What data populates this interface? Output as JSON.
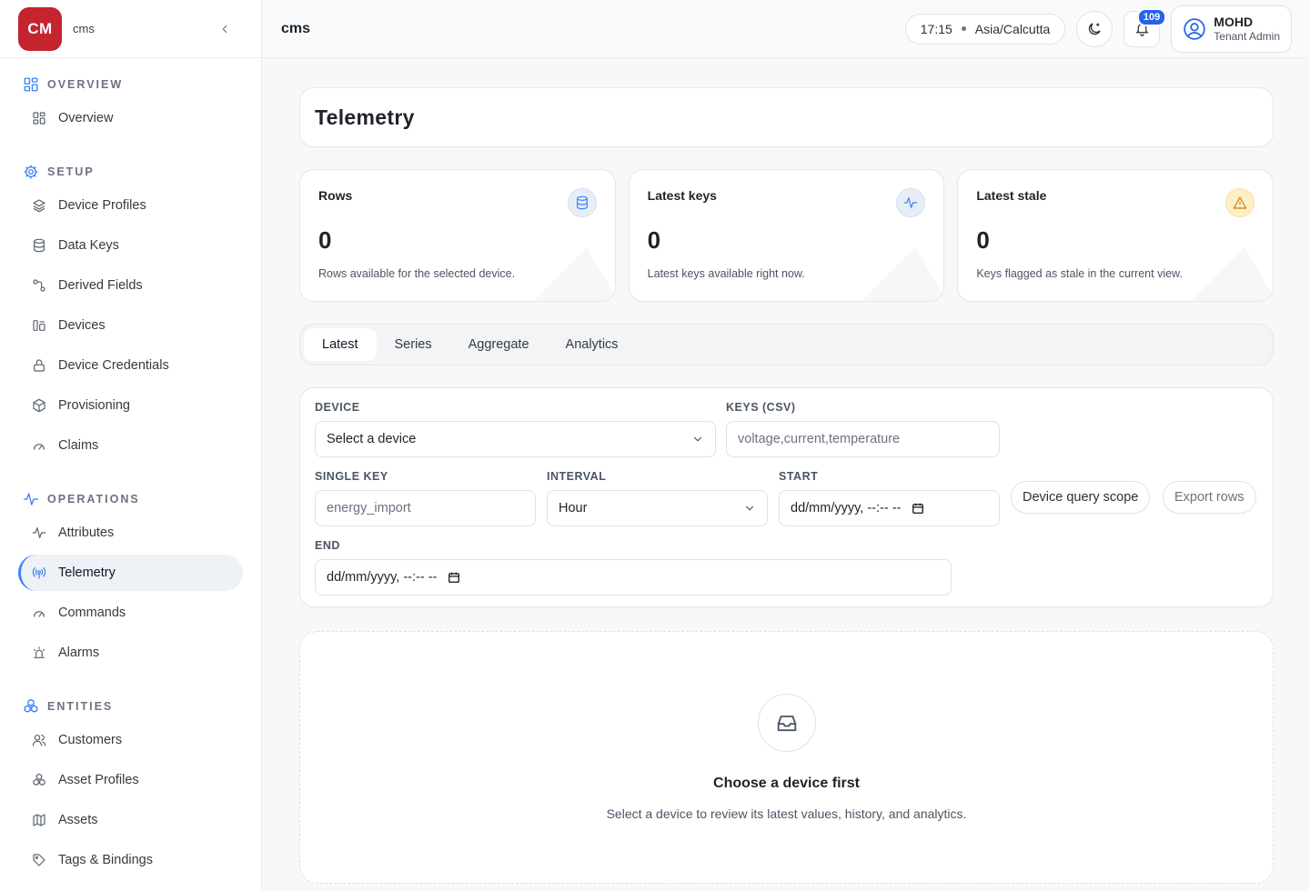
{
  "brand": {
    "logo_text": "CM",
    "name": "cms",
    "logo_color": "#c5232e"
  },
  "sidebar": {
    "sections": [
      {
        "label": "OVERVIEW",
        "icon": "grid-icon",
        "items": [
          {
            "label": "Overview",
            "icon": "grid-icon"
          }
        ]
      },
      {
        "label": "SETUP",
        "icon": "gear-icon",
        "items": [
          {
            "label": "Device Profiles",
            "icon": "layers-icon"
          },
          {
            "label": "Data Keys",
            "icon": "database-icon"
          },
          {
            "label": "Derived Fields",
            "icon": "flow-icon"
          },
          {
            "label": "Devices",
            "icon": "devices-icon"
          },
          {
            "label": "Device Credentials",
            "icon": "lock-icon"
          },
          {
            "label": "Provisioning",
            "icon": "box-icon"
          },
          {
            "label": "Claims",
            "icon": "gauge-icon"
          }
        ]
      },
      {
        "label": "OPERATIONS",
        "icon": "activity-icon",
        "items": [
          {
            "label": "Attributes",
            "icon": "activity-icon"
          },
          {
            "label": "Telemetry",
            "icon": "broadcast-icon",
            "active": true
          },
          {
            "label": "Commands",
            "icon": "gauge-icon"
          },
          {
            "label": "Alarms",
            "icon": "siren-icon"
          }
        ]
      },
      {
        "label": "ENTITIES",
        "icon": "boxes-icon",
        "items": [
          {
            "label": "Customers",
            "icon": "users-icon"
          },
          {
            "label": "Asset Profiles",
            "icon": "boxes-icon"
          },
          {
            "label": "Assets",
            "icon": "map-icon"
          },
          {
            "label": "Tags & Bindings",
            "icon": "tag-icon"
          }
        ]
      }
    ]
  },
  "topbar": {
    "title": "cms",
    "time": "17:15",
    "timezone": "Asia/Calcutta",
    "notifications": "109",
    "user": {
      "name": "MOHD",
      "role": "Tenant Admin"
    }
  },
  "page": {
    "title": "Telemetry"
  },
  "stats": [
    {
      "label": "Rows",
      "value": "0",
      "desc": "Rows available for the selected device.",
      "icon": "database-icon",
      "icon_bg": "#e8eef8",
      "icon_color": "#3b82f6"
    },
    {
      "label": "Latest keys",
      "value": "0",
      "desc": "Latest keys available right now.",
      "icon": "activity-icon",
      "icon_bg": "#e8eef8",
      "icon_color": "#3b82f6"
    },
    {
      "label": "Latest stale",
      "value": "0",
      "desc": "Keys flagged as stale in the current view.",
      "icon": "warning-icon",
      "icon_bg": "#fdf0c7",
      "icon_color": "#d97706"
    }
  ],
  "tabs": [
    {
      "label": "Latest",
      "active": true
    },
    {
      "label": "Series"
    },
    {
      "label": "Aggregate"
    },
    {
      "label": "Analytics"
    }
  ],
  "filters": {
    "device_label": "DEVICE",
    "device_value": "Select a device",
    "keys_label": "KEYS (CSV)",
    "keys_placeholder": "voltage,current,temperature",
    "single_key_label": "SINGLE KEY",
    "single_key_placeholder": "energy_import",
    "interval_label": "INTERVAL",
    "interval_value": "Hour",
    "start_label": "START",
    "start_placeholder": "dd/mm/yyyy, --:-- --",
    "end_label": "END",
    "end_placeholder": "dd/mm/yyyy, --:-- --",
    "scope_button": "Device query scope",
    "export_button": "Export rows"
  },
  "empty": {
    "title": "Choose a device first",
    "desc": "Select a device to review its latest values, history, and analytics."
  }
}
